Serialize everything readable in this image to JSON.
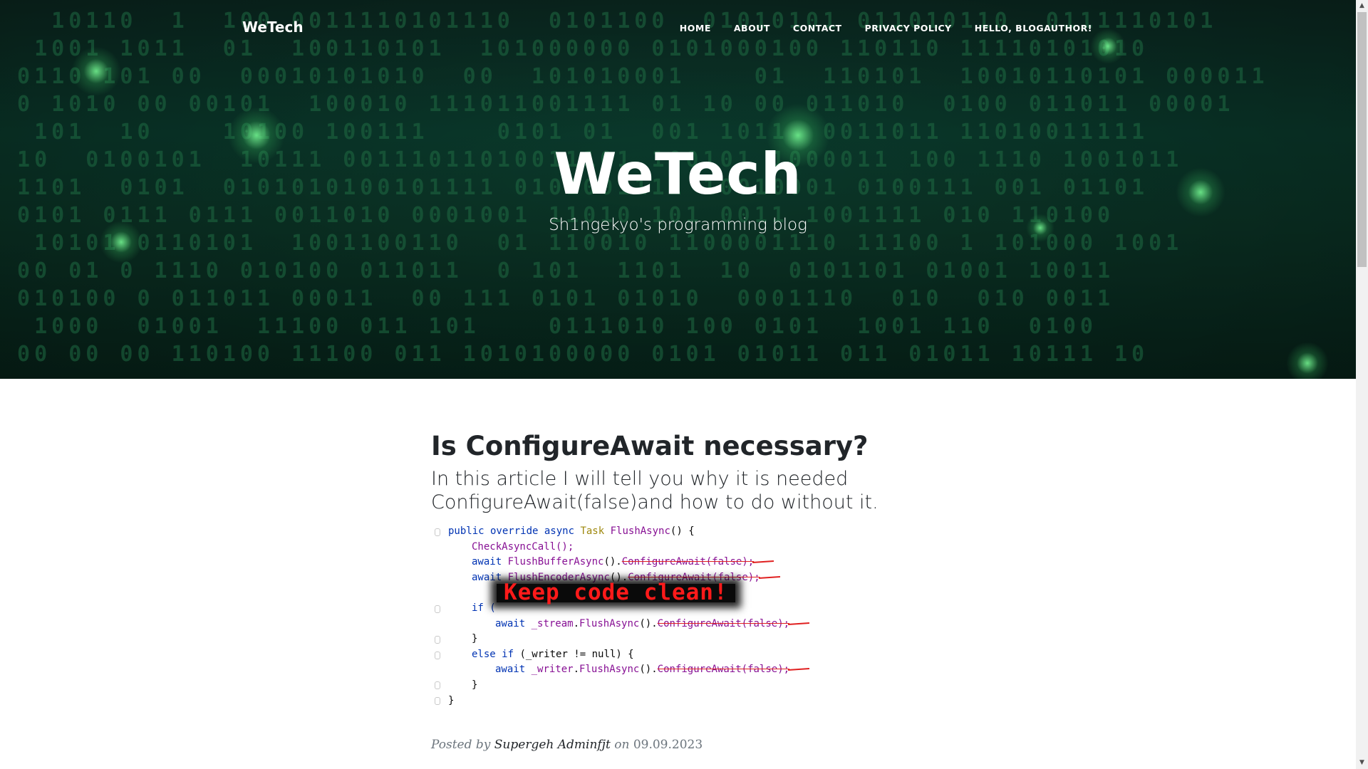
{
  "nav": {
    "brand": "WeTech",
    "links": [
      "HOME",
      "ABOUT",
      "CONTACT",
      "PRIVACY POLICY",
      "HELLO, BLOGAUTHOR!"
    ]
  },
  "hero": {
    "title": "WeTech",
    "subtitle": "Sh1ngekyo's programming blog"
  },
  "post": {
    "title": "Is ConfigureAwait necessary?",
    "subtitle": "In this article I will tell you why it is needed ConfigureAwait(false)and how to do without it.",
    "image_overlay_text": "Keep code clean!",
    "meta_prefix": "Posted by",
    "author": "Supergeh Adminfjt",
    "meta_on": "on",
    "date": "09.09.2023"
  },
  "code": {
    "l1_kw": "public override async",
    "l1_type": "Task",
    "l1_fn": "FlushAsync",
    "l1_rest": "() {",
    "l2": "CheckAsyncCall();",
    "l3_kw": "await",
    "l3_fn": "FlushBufferAsync",
    "l3_strike": "ConfigureAwait(false);",
    "l4_kw": "await",
    "l4_fn": "FlushEncoderAsync",
    "l4_strike": "ConfigureAwait(false);",
    "l5": "if (",
    "l6_kw": "await",
    "l6_var": "_stream",
    "l6_fn": "FlushAsync",
    "l6_strike": "ConfigureAwait(false);",
    "l7": "}",
    "l8_kw": "else if",
    "l8_rest": "(_writer != null) {",
    "l9_kw": "await",
    "l9_var": "_writer",
    "l9_fn": "FlushAsync",
    "l9_strike": "ConfigureAwait(false);",
    "l10": "}",
    "l11": "}"
  },
  "colors": {
    "hero_bg": "#0a3a2c",
    "binary_text": "#1f6b43",
    "overlay_text": "#ff1a1a",
    "strike": "#e02020"
  }
}
